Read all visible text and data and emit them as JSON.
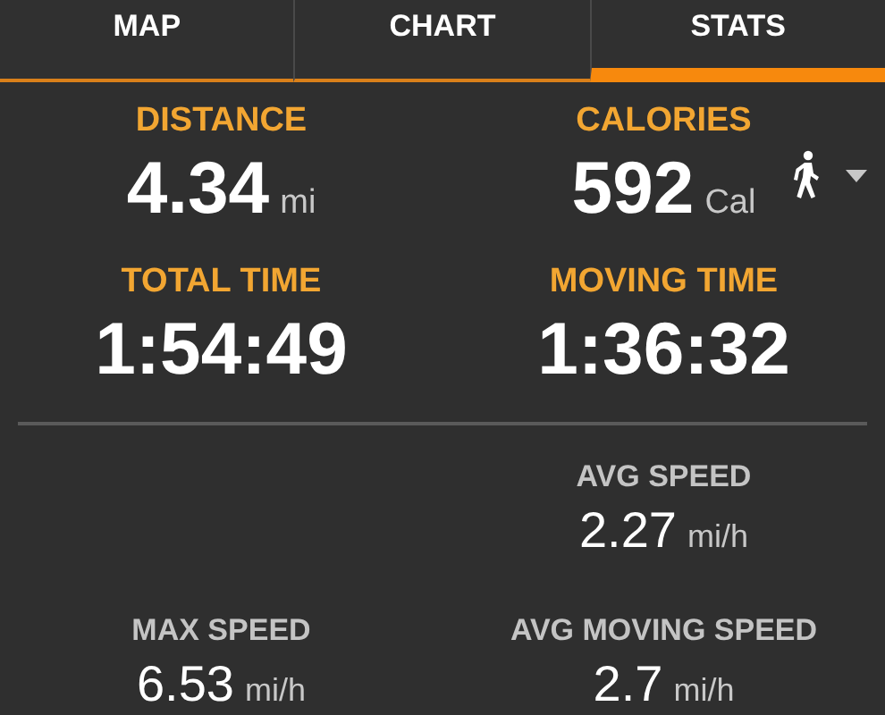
{
  "tabs": [
    {
      "label": "MAP",
      "selected": false
    },
    {
      "label": "CHART",
      "selected": false
    },
    {
      "label": "STATS",
      "selected": true
    }
  ],
  "main_stats": [
    {
      "left": {
        "label": "DISTANCE",
        "value": "4.34",
        "unit": "mi"
      },
      "right": {
        "label": "CALORIES",
        "value": "592",
        "unit": "Cal",
        "activity_picker": true
      }
    },
    {
      "left": {
        "label": "TOTAL TIME",
        "value": "1:54:49"
      },
      "right": {
        "label": "MOVING TIME",
        "value": "1:36:32"
      }
    }
  ],
  "speed_stats": [
    {
      "right": {
        "label": "AVG SPEED",
        "value": "2.27",
        "unit": "mi/h"
      }
    },
    {
      "left": {
        "label": "MAX SPEED",
        "value": "6.53",
        "unit": "mi/h"
      },
      "right": {
        "label": "AVG MOVING SPEED",
        "value": "2.7",
        "unit": "mi/h"
      }
    }
  ]
}
